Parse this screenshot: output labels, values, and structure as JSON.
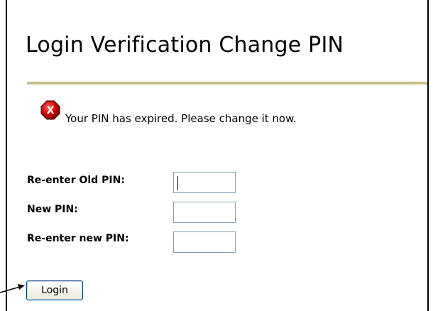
{
  "page": {
    "title": "Login Verification Change PIN"
  },
  "colors": {
    "title_rule": "#c5c189",
    "error_icon": "#cc0000",
    "input_border": "#7f9db9",
    "button_border": "#003c74"
  },
  "error": {
    "icon": "error-x-icon",
    "icon_glyph": "X",
    "message": "Your PIN has expired. Please change it now."
  },
  "form": {
    "fields": [
      {
        "label": "Re-enter Old PIN:",
        "value": ""
      },
      {
        "label": "New PIN:",
        "value": ""
      },
      {
        "label": "Re-enter new PIN:",
        "value": ""
      }
    ],
    "submit_label": "Login"
  },
  "annotation": {
    "icon": "pointer-arrow-icon"
  }
}
